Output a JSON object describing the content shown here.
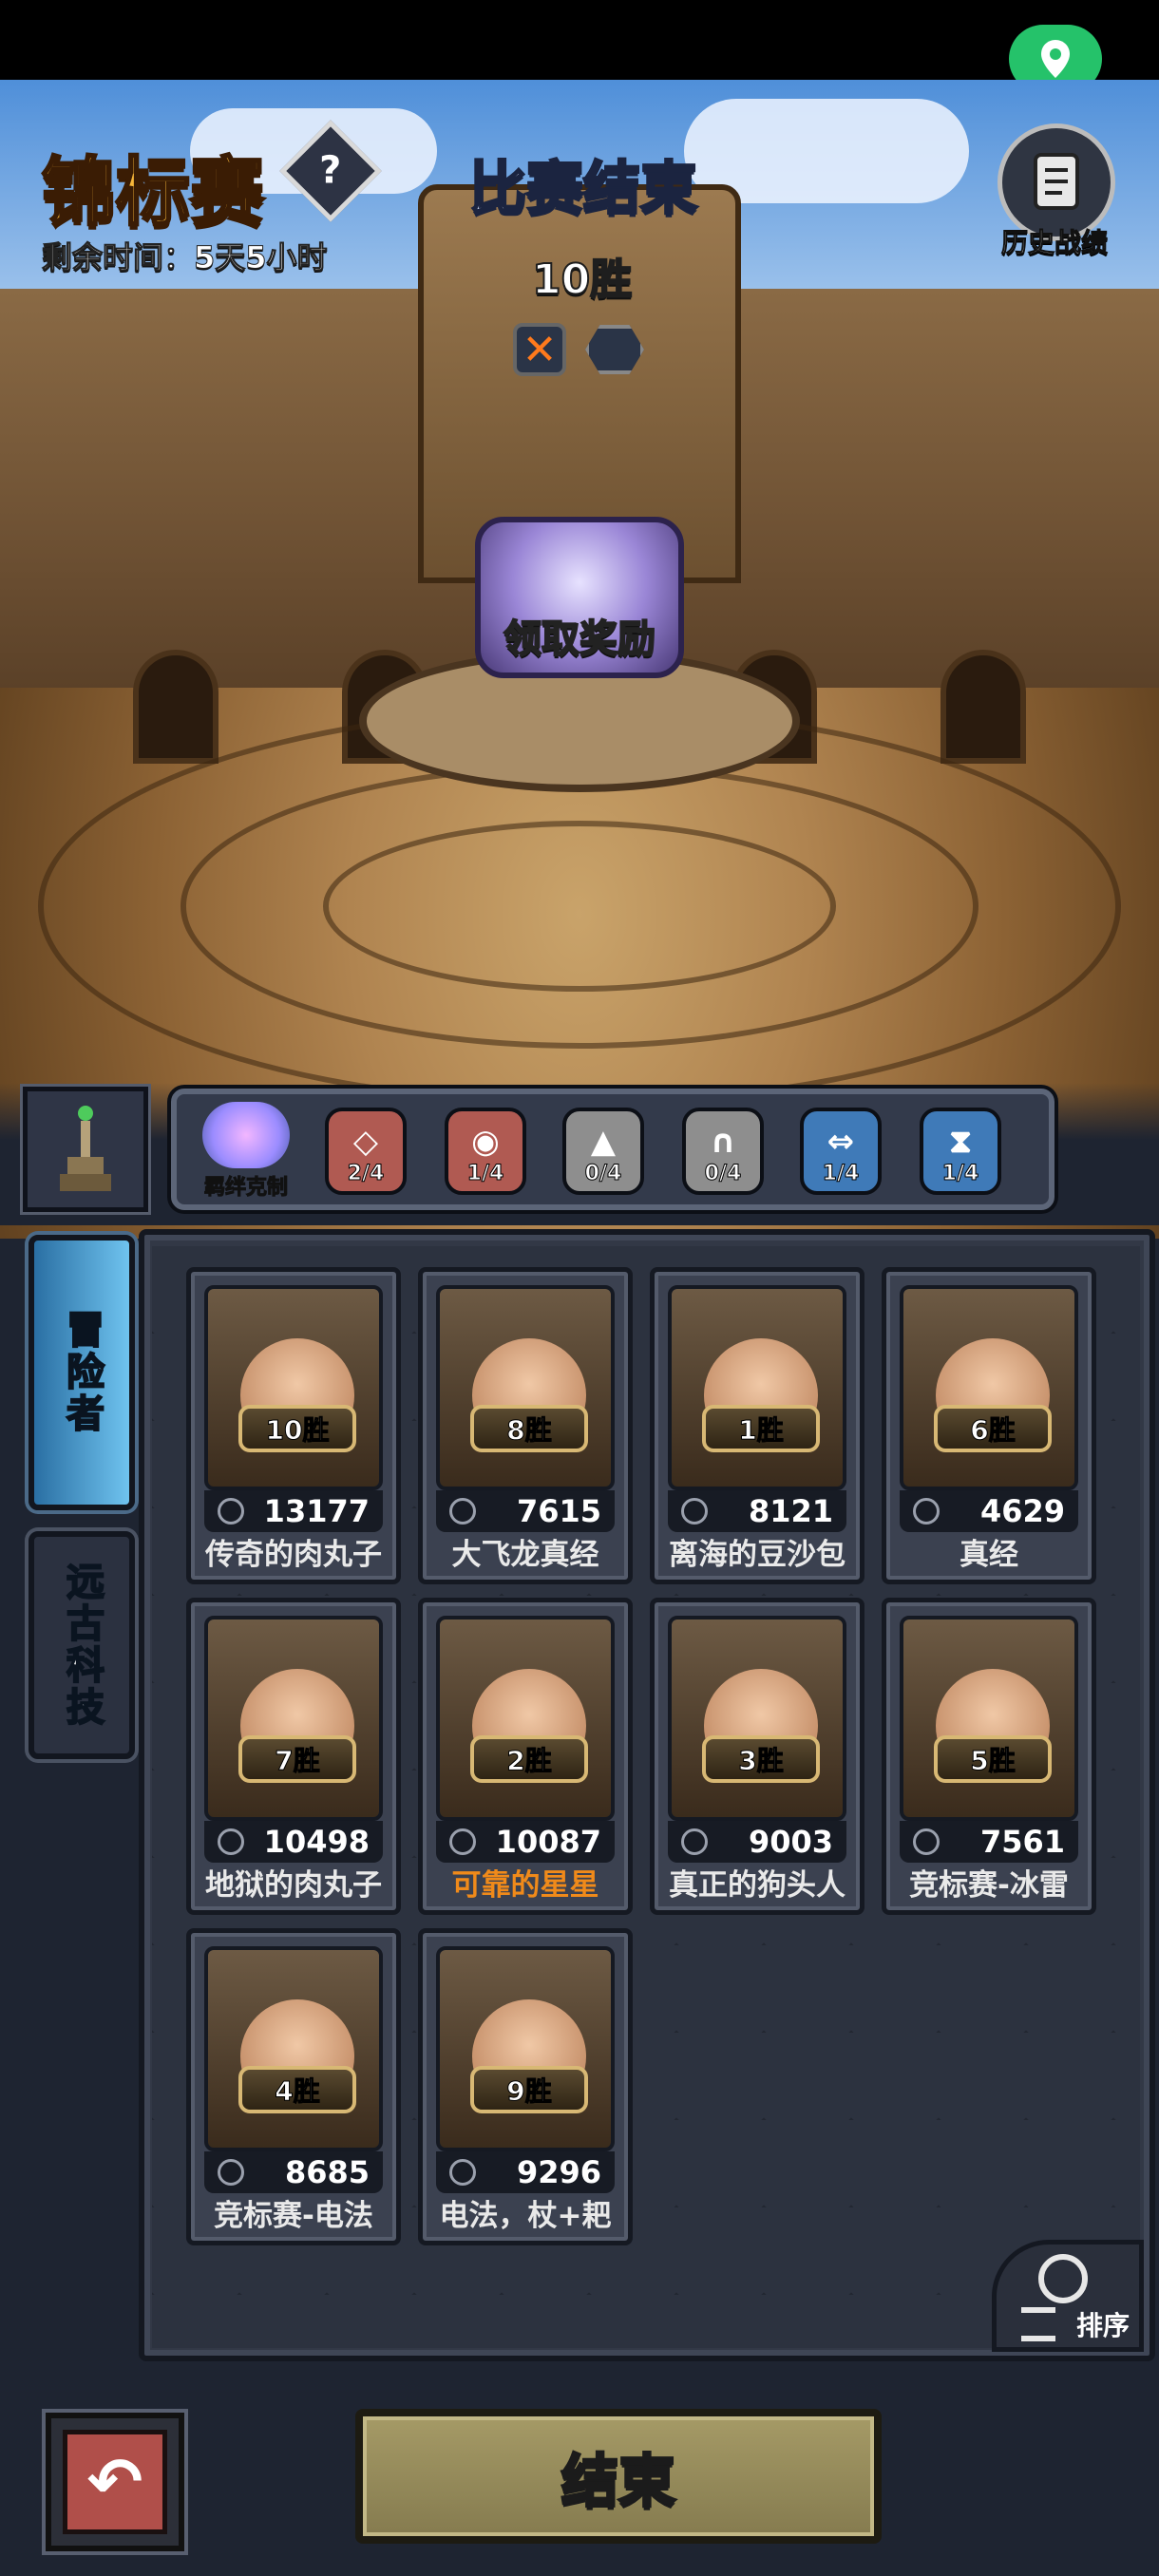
{
  "header": {
    "title": "锦标赛",
    "help_icon": "?",
    "remaining_time": "剩余时间：5天5小时",
    "status": "比赛结束",
    "wins": "10胜",
    "loss_mark": "✕",
    "claim_reward": "领取奖励",
    "history_label": "历史战绩"
  },
  "bond_bar": {
    "label": "羁绊克制",
    "badges": [
      {
        "icon": "diamond-icon",
        "symbol": "◇",
        "count": "2/4",
        "color": "#b05a52"
      },
      {
        "icon": "eye-icon",
        "symbol": "◉",
        "count": "1/4",
        "color": "#b05a52"
      },
      {
        "icon": "spikes-icon",
        "symbol": "▲",
        "count": "0/4",
        "color": "#8e8e8e"
      },
      {
        "icon": "horseshoe-icon",
        "symbol": "∩",
        "count": "0/4",
        "color": "#8e8e8e"
      },
      {
        "icon": "arrows-icon",
        "symbol": "⇔",
        "count": "1/4",
        "color": "#3f7ab8"
      },
      {
        "icon": "hourglass-icon",
        "symbol": "⧗",
        "count": "1/4",
        "color": "#3f7ab8"
      }
    ]
  },
  "side_tabs": {
    "adventurer": "冒险者",
    "tech": "远古科技"
  },
  "roster": [
    {
      "wins": "10胜",
      "power": "13177",
      "name": "传奇的肉丸子",
      "highlight": false
    },
    {
      "wins": "8胜",
      "power": "7615",
      "name": "大飞龙真经",
      "highlight": false
    },
    {
      "wins": "1胜",
      "power": "8121",
      "name": "离海的豆沙包",
      "highlight": false
    },
    {
      "wins": "6胜",
      "power": "4629",
      "name": "真经",
      "highlight": false
    },
    {
      "wins": "7胜",
      "power": "10498",
      "name": "地狱的肉丸子",
      "highlight": false
    },
    {
      "wins": "2胜",
      "power": "10087",
      "name": "可靠的星星",
      "highlight": true
    },
    {
      "wins": "3胜",
      "power": "9003",
      "name": "真正的狗头人",
      "highlight": false
    },
    {
      "wins": "5胜",
      "power": "7561",
      "name": "竞标赛-冰雷",
      "highlight": false
    },
    {
      "wins": "4胜",
      "power": "8685",
      "name": "竞标赛-电法",
      "highlight": false
    },
    {
      "wins": "9胜",
      "power": "9296",
      "name": "电法，杖+耙",
      "highlight": false
    }
  ],
  "sort_label": "排序",
  "back_symbol": "↶",
  "end_button": "结束"
}
